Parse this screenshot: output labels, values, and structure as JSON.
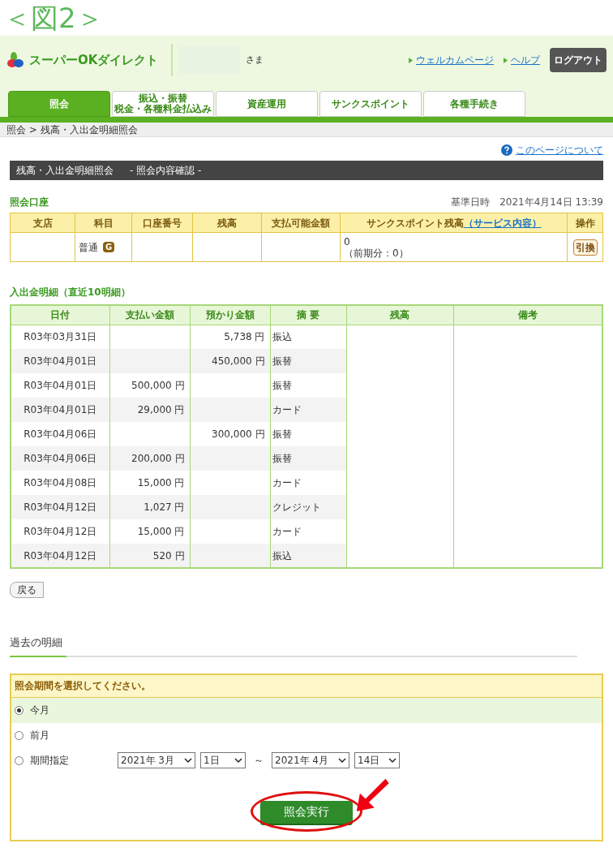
{
  "figure_label": "＜図2＞",
  "header": {
    "logo_text": "スーパーOKダイレクト",
    "honorific": "さま",
    "links": [
      "ウェルカムページ",
      "ヘルプ"
    ],
    "logout": "ログアウト"
  },
  "tabs": [
    {
      "label": "照会",
      "selected": true
    },
    {
      "label": "振込・振替",
      "sublabel": "税金・各種料金払込み",
      "selected": false
    },
    {
      "label": "資産運用",
      "selected": false
    },
    {
      "label": "サンクスポイント",
      "selected": false
    },
    {
      "label": "各種手続き",
      "selected": false
    }
  ],
  "breadcrumb": "照会 > 残高・入出金明細照会",
  "help_link": "このページについて",
  "page_title": "残高・入出金明細照会",
  "page_subtitle": "- 照会内容確認 -",
  "account": {
    "heading": "照会口座",
    "timestamp_label": "基準日時",
    "timestamp": "2021年4月14日 13:39",
    "columns": [
      "支店",
      "科目",
      "口座番号",
      "残高",
      "支払可能金額",
      "サンクスポイント残高",
      "操作"
    ],
    "point_link": "（サービス内容）",
    "row": {
      "type": "普通",
      "badge": "G",
      "points": "0",
      "points_previous": "（前期分：0）",
      "action": "引換"
    }
  },
  "transactions": {
    "heading": "入出金明細（直近10明細）",
    "columns": [
      "日付",
      "支払い金額",
      "預かり金額",
      "摘 要",
      "残高",
      "備考"
    ],
    "rows": [
      {
        "date": "R03年03月31日",
        "deposit": "5,738 円",
        "description": "振込"
      },
      {
        "date": "R03年04月01日",
        "deposit": "450,000 円",
        "description": "振替"
      },
      {
        "date": "R03年04月01日",
        "withdrawal": "500,000 円",
        "description": "振替"
      },
      {
        "date": "R03年04月01日",
        "withdrawal": "29,000 円",
        "description": "カード"
      },
      {
        "date": "R03年04月06日",
        "deposit": "300,000 円",
        "description": "振替"
      },
      {
        "date": "R03年04月06日",
        "withdrawal": "200,000 円",
        "description": "振替"
      },
      {
        "date": "R03年04月08日",
        "withdrawal": "15,000 円",
        "description": "カード"
      },
      {
        "date": "R03年04月12日",
        "withdrawal": "1,027 円",
        "description": "クレジット"
      },
      {
        "date": "R03年04月12日",
        "withdrawal": "15,000 円",
        "description": "カード"
      },
      {
        "date": "R03年04月12日",
        "withdrawal": "520 円",
        "description": "振込"
      }
    ]
  },
  "back_button": "戻る",
  "past": {
    "heading": "過去の明細",
    "prompt": "照会期間を選択してください。",
    "options": [
      {
        "label": "今月",
        "selected": true
      },
      {
        "label": "前月",
        "selected": false
      },
      {
        "label": "期間指定",
        "selected": false
      }
    ],
    "range": {
      "from_month": "2021年 3月",
      "from_day": "1日",
      "separator": "～",
      "to_month": "2021年 4月",
      "to_day": "14日"
    },
    "submit": "照会実行"
  }
}
